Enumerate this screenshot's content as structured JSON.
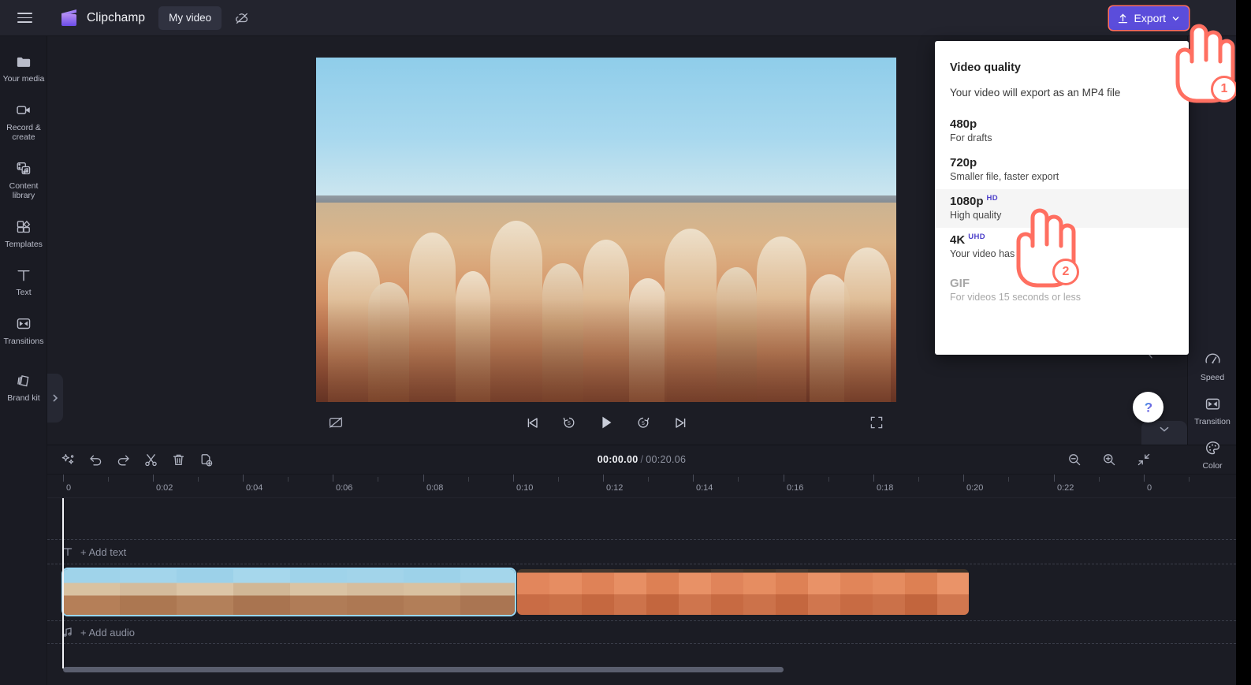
{
  "app": {
    "brand_name": "Clipchamp",
    "project_name": "My video",
    "menu_icon": "hamburger-icon",
    "logo_icon": "clipchamp-logo-icon",
    "cloud_icon": "cloud-off-icon"
  },
  "topbar": {
    "export_label": "Export",
    "export_icon": "upload-arrow-icon",
    "export_chevron": "chevron-down-icon",
    "export_color": "#5b4ddb"
  },
  "sidebar": {
    "items": [
      {
        "label": "Your media",
        "icon": "folder-icon"
      },
      {
        "label": "Record & create",
        "icon": "video-camera-icon"
      },
      {
        "label": "Content library",
        "icon": "content-library-icon"
      },
      {
        "label": "Templates",
        "icon": "templates-icon"
      },
      {
        "label": "Text",
        "icon": "text-t-icon"
      },
      {
        "label": "Transitions",
        "icon": "transitions-icon"
      },
      {
        "label": "Brand kit",
        "icon": "brand-kit-icon"
      }
    ],
    "expand_icon": "chevron-right-icon"
  },
  "preview": {
    "controls": [
      {
        "name": "captions-off-button",
        "icon": "closed-captions-off-icon"
      },
      {
        "name": "skip-previous-button",
        "icon": "skip-previous-icon"
      },
      {
        "name": "rewind-5-button",
        "icon": "rewind-5-icon"
      },
      {
        "name": "play-button",
        "icon": "play-icon"
      },
      {
        "name": "forward-5-button",
        "icon": "forward-5-icon"
      },
      {
        "name": "skip-next-button",
        "icon": "skip-next-icon"
      },
      {
        "name": "fullscreen-button",
        "icon": "fullscreen-icon"
      }
    ]
  },
  "property_rail": {
    "items": [
      {
        "label": "Speed",
        "icon": "speedometer-icon"
      },
      {
        "label": "Transition",
        "icon": "transition-icon"
      },
      {
        "label": "Color",
        "icon": "palette-icon"
      }
    ],
    "collapse_icon": "chevron-left-icon"
  },
  "help": {
    "icon": "question-mark-icon"
  },
  "collapse_tab": {
    "icon": "chevron-down-icon"
  },
  "timeline": {
    "tools": [
      {
        "name": "magic-suggestions-button",
        "icon": "sparkle-icon"
      },
      {
        "name": "undo-button",
        "icon": "undo-arrow-icon"
      },
      {
        "name": "redo-button",
        "icon": "redo-arrow-icon"
      },
      {
        "name": "split-button",
        "icon": "scissors-icon"
      },
      {
        "name": "delete-button",
        "icon": "trash-icon"
      },
      {
        "name": "duplicate-button",
        "icon": "duplicate-icon"
      }
    ],
    "zoom_tools": [
      {
        "name": "zoom-out-button",
        "icon": "magnifier-minus-icon"
      },
      {
        "name": "zoom-in-button",
        "icon": "magnifier-plus-icon"
      },
      {
        "name": "fit-to-screen-button",
        "icon": "fit-arrows-icon"
      }
    ],
    "current_time": "00:00.00",
    "separator": "/",
    "total_time": "00:20.06",
    "ruler_labels": [
      "0",
      "0:02",
      "0:04",
      "0:06",
      "0:08",
      "0:10",
      "0:12",
      "0:14",
      "0:16",
      "0:18",
      "0:20",
      "0:22",
      "0"
    ],
    "add_text_label": "+ Add text",
    "add_text_icon": "text-t-icon",
    "add_audio_label": "+ Add audio",
    "add_audio_icon": "music-note-icon",
    "clips": [
      {
        "name": "video-clip-1",
        "selected": true
      },
      {
        "name": "video-clip-2",
        "selected": false
      }
    ]
  },
  "export_panel": {
    "title": "Video quality",
    "subtitle": "Your video will export as an MP4 file",
    "options": [
      {
        "name": "480p",
        "badge": "",
        "desc": "For drafts",
        "state": "normal"
      },
      {
        "name": "720p",
        "badge": "",
        "desc": "Smaller file, faster export",
        "state": "normal"
      },
      {
        "name": "1080p",
        "badge": "HD",
        "desc": "High quality",
        "state": "hovered"
      },
      {
        "name": "4K",
        "badge": "UHD",
        "desc": "Your video has no 4K media",
        "state": "normal"
      },
      {
        "name": "GIF",
        "badge": "",
        "desc": "For videos 15 seconds or less",
        "state": "disabled"
      }
    ],
    "badge_color": "#4b3ec9"
  },
  "annotations": {
    "accent_color": "#ff6f61",
    "steps": [
      {
        "number": "1",
        "target": "export-button"
      },
      {
        "number": "2",
        "target": "1080p-option"
      }
    ]
  }
}
